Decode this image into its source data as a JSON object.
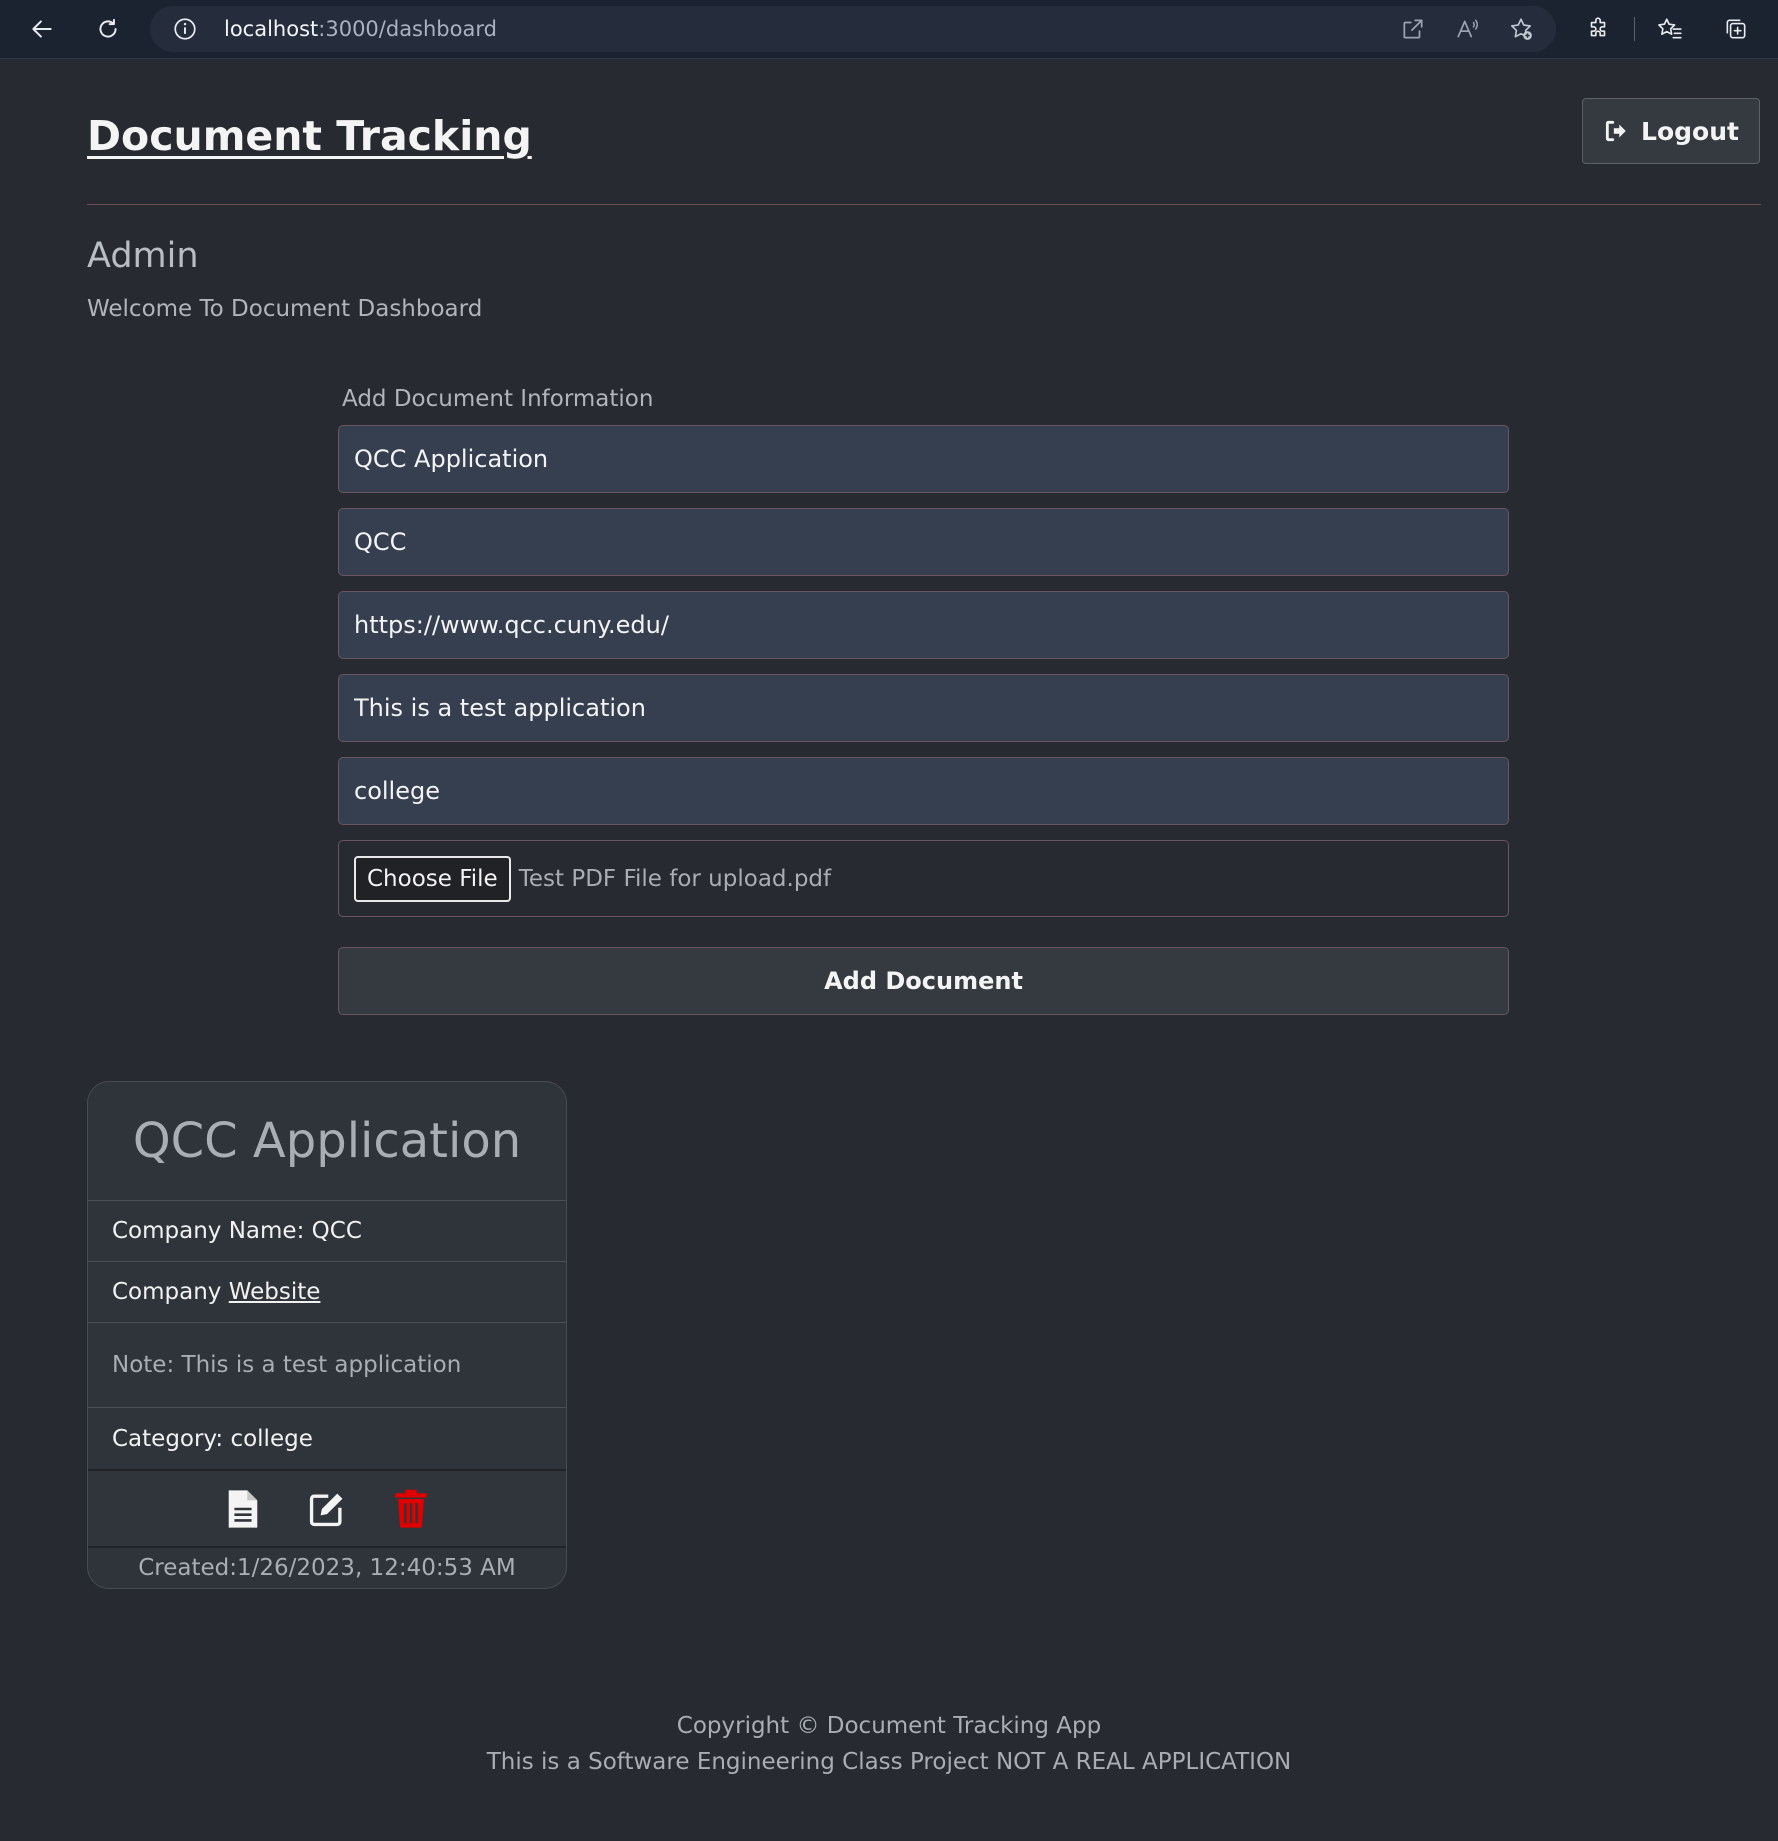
{
  "browser": {
    "url_host": "localhost",
    "url_path": ":3000/dashboard"
  },
  "header": {
    "brand": "Document Tracking",
    "logout_label": "Logout"
  },
  "user": {
    "role": "Admin",
    "welcome": "Welcome To Document Dashboard"
  },
  "form": {
    "heading": "Add Document Information",
    "fields": {
      "title": "QCC Application",
      "company": "QCC",
      "website": "https://www.qcc.cuny.edu/",
      "note": "This is a test application",
      "category": "college"
    },
    "file": {
      "button_label": "Choose File",
      "file_name": "Test PDF File for upload.pdf"
    },
    "submit_label": "Add Document"
  },
  "card": {
    "title": "QCC Application",
    "company_label": "Company Name: ",
    "company_value": "QCC",
    "website_label": "Company ",
    "website_link": "Website",
    "note_label": "Note: ",
    "note_value": "This is a test application",
    "category_label": "Category: ",
    "category_value": "college",
    "created": "Created:1/26/2023, 12:40:53 AM",
    "icons": [
      "document-icon",
      "edit-icon",
      "trash-icon"
    ],
    "delete_color": "#e00000"
  },
  "footer": {
    "copyright": "Copyright © Document Tracking App",
    "disclaimer": "This is a Software Engineering Class Project NOT A REAL APPLICATION"
  }
}
